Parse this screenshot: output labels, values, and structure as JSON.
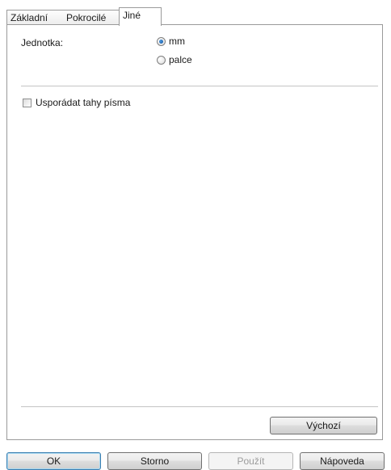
{
  "tabs": [
    {
      "label": "Základní",
      "active": false
    },
    {
      "label": "Pokrocilé",
      "active": false
    },
    {
      "label": "Jiné",
      "active": true
    }
  ],
  "unit": {
    "label": "Jednotka:",
    "options": [
      {
        "label": "mm",
        "checked": true
      },
      {
        "label": "palce",
        "checked": false
      }
    ]
  },
  "arrange_strokes": {
    "label": "Usporádat tahy písma",
    "checked": false
  },
  "buttons": {
    "defaults": "Výchozí",
    "ok": "OK",
    "cancel": "Storno",
    "apply": "Použít",
    "help": "Nápoveda"
  },
  "colors": {
    "radio_selected": "#0d4f9c",
    "disabled_text": "#9c9c9c",
    "border": "#9a9a9a"
  }
}
